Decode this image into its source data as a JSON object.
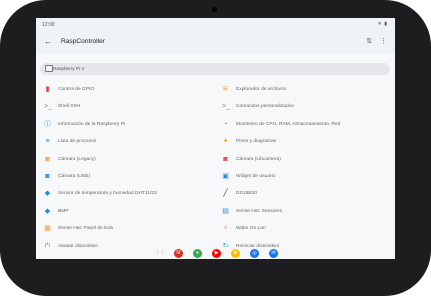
{
  "status": {
    "time": "12:00"
  },
  "appbar": {
    "title": "RaspController",
    "back_icon": "arrow-back-icon",
    "action_icons": [
      "sort-icon",
      "more-vert-icon"
    ]
  },
  "device_selector": {
    "label": "Raspberry Pi 4",
    "icon": "laptop-icon"
  },
  "colors": {
    "red": "#e53935",
    "orange": "#f39c2f",
    "blue": "#1e88e5",
    "teal": "#26a69a",
    "gray": "#888888"
  },
  "menu_left": [
    {
      "label": "Control de GPIO",
      "icon": "gpio-icon",
      "color": "#e53935"
    },
    {
      "label": "Shell SSH",
      "icon": "terminal-icon",
      "color": "#888888"
    },
    {
      "label": "Información de la Raspberry Pi",
      "icon": "info-icon",
      "color": "#1e88e5"
    },
    {
      "label": "Lista de procesos",
      "icon": "process-list-icon",
      "color": "#1e88e5"
    },
    {
      "label": "Cámara (Legacy)",
      "icon": "camera-icon",
      "color": "#f39c2f"
    },
    {
      "label": "Cámara (USB)",
      "icon": "camera-icon",
      "color": "#1e88e5"
    },
    {
      "label": "Sensor de temperatura y humedad DHT11/22",
      "icon": "thermometer-icon",
      "color": "#1e88e5"
    },
    {
      "label": "BMP",
      "icon": "pressure-icon",
      "color": "#1e88e5"
    },
    {
      "label": "Sense Hat: Panel de leds",
      "icon": "led-panel-icon",
      "color": "#f39c2f"
    },
    {
      "label": "Apagar dispositivo",
      "icon": "power-icon",
      "color": "#1e88e5"
    }
  ],
  "menu_right": [
    {
      "label": "Explorador de archivos",
      "icon": "folder-icon",
      "color": "#f39c2f"
    },
    {
      "label": "Comandos personalizados",
      "icon": "command-icon",
      "color": "#888888"
    },
    {
      "label": "Monitoreo de CPU, RAM, Almacenamiento, Red",
      "icon": "monitor-icon",
      "color": "#26a69a"
    },
    {
      "label": "Pines y diagramas",
      "icon": "pins-icon",
      "color": "#f39c2f"
    },
    {
      "label": "Cámara (Libcamera)",
      "icon": "camera-icon",
      "color": "#e53935"
    },
    {
      "label": "Widget de usuario",
      "icon": "widget-icon",
      "color": "#1e88e5"
    },
    {
      "label": "DS18B20",
      "icon": "probe-icon",
      "color": "#333333"
    },
    {
      "label": "Sense Hat: Sensores",
      "icon": "sensor-icon",
      "color": "#1e88e5"
    },
    {
      "label": "Wake On Lan",
      "icon": "wake-icon",
      "color": "#f39c2f"
    },
    {
      "label": "Reiniciar dispositivo",
      "icon": "restart-icon",
      "color": "#26a69a"
    }
  ],
  "navbar": [
    {
      "icon": "apps-grid-icon",
      "glyph": "⋮⋮",
      "bg": "#444444"
    },
    {
      "icon": "gmail-icon",
      "glyph": "M",
      "bg": "#d93025"
    },
    {
      "icon": "chrome-icon",
      "glyph": "●",
      "bg": "#34a853"
    },
    {
      "icon": "youtube-icon",
      "glyph": "▶",
      "bg": "#ff0000"
    },
    {
      "icon": "photos-icon",
      "glyph": "✿",
      "bg": "#fbbc04"
    },
    {
      "icon": "settings-app-icon",
      "glyph": "◎",
      "bg": "#1a73e8"
    },
    {
      "icon": "messages-icon",
      "glyph": "✉",
      "bg": "#1a73e8"
    }
  ]
}
